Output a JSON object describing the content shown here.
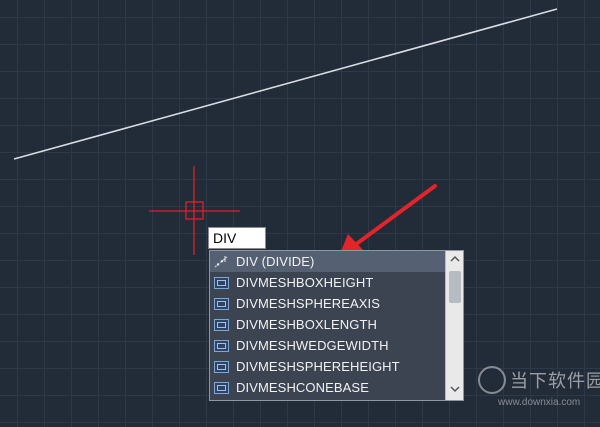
{
  "command_input": {
    "value": "DIV"
  },
  "suggestions": [
    {
      "label": "DIV (DIVIDE)",
      "icon": "divide-command-icon",
      "selected": true
    },
    {
      "label": "DIVMESHBOXHEIGHT",
      "icon": "system-variable-icon"
    },
    {
      "label": "DIVMESHSPHEREAXIS",
      "icon": "system-variable-icon"
    },
    {
      "label": "DIVMESHBOXLENGTH",
      "icon": "system-variable-icon"
    },
    {
      "label": "DIVMESHWEDGEWIDTH",
      "icon": "system-variable-icon"
    },
    {
      "label": "DIVMESHSPHEREHEIGHT",
      "icon": "system-variable-icon"
    },
    {
      "label": "DIVMESHCONEBASE",
      "icon": "system-variable-icon"
    }
  ],
  "watermark": {
    "brand": "当下软件园",
    "url": "www.downxia.com"
  },
  "colors": {
    "canvas_bg": "#222b38",
    "grid": "#2e3848",
    "line": "#d8dde4",
    "crosshair": "#e0202a",
    "arrow": "#e3242b"
  }
}
